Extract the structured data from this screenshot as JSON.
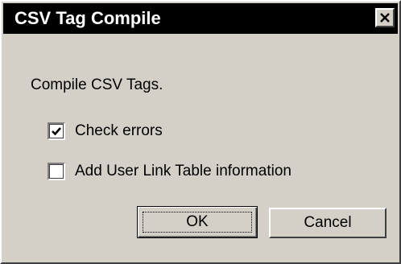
{
  "window": {
    "title": "CSV Tag Compile",
    "close_icon": "close-icon"
  },
  "dialog": {
    "message": "Compile CSV Tags."
  },
  "options": [
    {
      "label": "Check errors",
      "checked": true
    },
    {
      "label": "Add User Link Table information",
      "checked": false
    }
  ],
  "buttons": {
    "ok_label": "OK",
    "cancel_label": "Cancel"
  },
  "colors": {
    "titlebar": "#000000",
    "face": "#d4d0c8",
    "text": "#000000"
  }
}
